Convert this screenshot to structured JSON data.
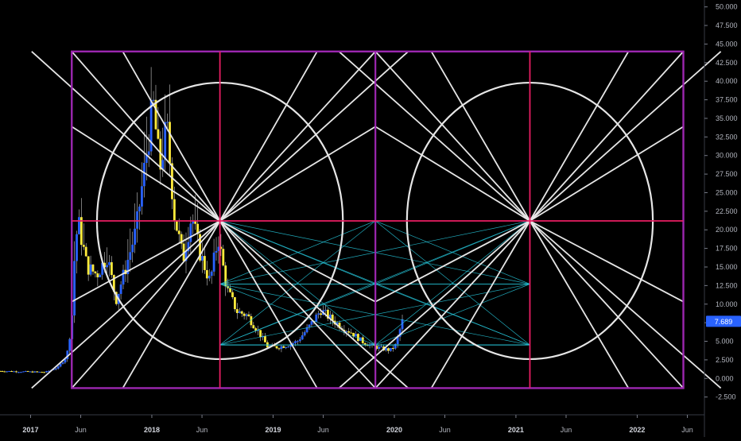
{
  "chart_data": {
    "type": "candlestick",
    "title": "",
    "xlabel": "",
    "ylabel": "",
    "y_axis_position": "right",
    "ylim": [
      -3.5,
      50.5
    ],
    "yticks": [
      50.0,
      47.5,
      45.0,
      42.5,
      40.0,
      37.5,
      35.0,
      32.5,
      30.0,
      27.5,
      25.0,
      22.5,
      20.0,
      17.5,
      15.0,
      12.5,
      10.0,
      7.5,
      5.0,
      2.5,
      0.0,
      -2.5
    ],
    "ytick_labels": [
      "50.000",
      "47.500",
      "45.000",
      "42.500",
      "40.000",
      "37.500",
      "35.000",
      "32.500",
      "30.000",
      "27.500",
      "25.000",
      "22.500",
      "20.000",
      "17.500",
      "15.000",
      "12.500",
      "10.000",
      "7.500",
      "5.000",
      "2.500",
      "0.000",
      "-2.500"
    ],
    "xlim": [
      "2016-10-01",
      "2022-07-20"
    ],
    "xticks": [
      {
        "date": "2017-01-01",
        "label": "2017",
        "major": true
      },
      {
        "date": "2017-06-01",
        "label": "Jun",
        "major": false
      },
      {
        "date": "2018-01-01",
        "label": "2018",
        "major": true
      },
      {
        "date": "2018-06-01",
        "label": "Jun",
        "major": false
      },
      {
        "date": "2019-01-01",
        "label": "2019",
        "major": true
      },
      {
        "date": "2019-06-01",
        "label": "Jun",
        "major": false
      },
      {
        "date": "2020-01-01",
        "label": "2020",
        "major": true
      },
      {
        "date": "2020-06-01",
        "label": "Jun",
        "major": false
      },
      {
        "date": "2021-01-01",
        "label": "2021",
        "major": true
      },
      {
        "date": "2021-06-01",
        "label": "Jun",
        "major": false
      },
      {
        "date": "2022-01-01",
        "label": "2022",
        "major": true
      },
      {
        "date": "2022-06-01",
        "label": "Jun",
        "major": false
      }
    ],
    "last_price": {
      "value": 7.689,
      "label": "7.689",
      "color": "#2962ff"
    },
    "price_anchors": [
      [
        "2016-10-01",
        1.0
      ],
      [
        "2016-12-15",
        0.9
      ],
      [
        "2017-02-15",
        0.85
      ],
      [
        "2017-03-25",
        1.5
      ],
      [
        "2017-04-20",
        3.0
      ],
      [
        "2017-05-05",
        7.5
      ],
      [
        "2017-05-15",
        18.0
      ],
      [
        "2017-05-25",
        21.0
      ],
      [
        "2017-06-20",
        15.0
      ],
      [
        "2017-07-20",
        14.0
      ],
      [
        "2017-08-20",
        16.5
      ],
      [
        "2017-09-15",
        10.5
      ],
      [
        "2017-10-15",
        15.0
      ],
      [
        "2017-11-15",
        20.0
      ],
      [
        "2017-12-15",
        30.0
      ],
      [
        "2018-01-05",
        37.0
      ],
      [
        "2018-01-25",
        28.0
      ],
      [
        "2018-02-15",
        34.0
      ],
      [
        "2018-03-10",
        22.0
      ],
      [
        "2018-04-05",
        16.0
      ],
      [
        "2018-05-01",
        22.0
      ],
      [
        "2018-05-25",
        17.0
      ],
      [
        "2018-06-25",
        13.0
      ],
      [
        "2018-07-20",
        19.0
      ],
      [
        "2018-08-15",
        12.0
      ],
      [
        "2018-09-15",
        9.0
      ],
      [
        "2018-10-15",
        8.5
      ],
      [
        "2018-11-15",
        6.5
      ],
      [
        "2018-12-15",
        4.3
      ],
      [
        "2019-01-15",
        4.2
      ],
      [
        "2019-02-15",
        4.5
      ],
      [
        "2019-03-15",
        5.0
      ],
      [
        "2019-04-20",
        7.0
      ],
      [
        "2019-05-25",
        9.2
      ],
      [
        "2019-06-25",
        8.0
      ],
      [
        "2019-07-25",
        7.0
      ],
      [
        "2019-08-25",
        6.2
      ],
      [
        "2019-09-25",
        5.0
      ],
      [
        "2019-10-25",
        4.4
      ],
      [
        "2019-11-25",
        4.0
      ],
      [
        "2019-12-20",
        3.8
      ],
      [
        "2020-01-05",
        4.5
      ],
      [
        "2020-01-25",
        7.689
      ]
    ],
    "overlay": {
      "colors": {
        "frame": "#9c27b0",
        "mid_lines": "#e91e63",
        "spokes": "#e6e6e6",
        "circles": "#e6e6e6",
        "cyan": "#26c6da",
        "blue_line": "#2196f3",
        "bull": "#2962ff",
        "bear": "#ffeb3b"
      },
      "left_x": "2017-05-05",
      "center1_x": "2018-07-25",
      "mid_x": "2019-11-05",
      "center2_x": "2021-02-12",
      "right_x": "2022-05-20",
      "top_y": 44.0,
      "bottom_y": -1.3,
      "center_y": 21.2,
      "circle_radius_y": 18.6,
      "cyan_box": {
        "y_top": 21.2,
        "y_mid": 12.7,
        "y_bottom": 4.5,
        "x_right": "2021-02-12"
      }
    }
  }
}
